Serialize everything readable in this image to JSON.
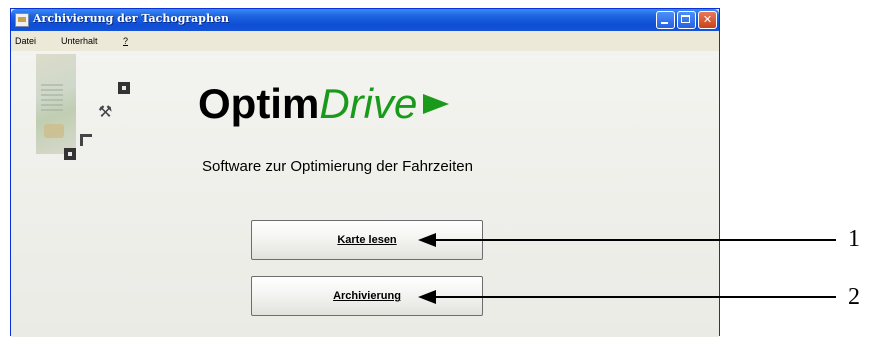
{
  "window": {
    "title": "Archivierung der Tachographen",
    "controls": {
      "minimize": "_",
      "maximize": "□",
      "close": "✕"
    }
  },
  "menu": {
    "items": [
      "Datei",
      "Unterhalt",
      "?"
    ]
  },
  "logo": {
    "part1": "Optim",
    "part2": "Drive",
    "accent_color": "#1a9a1a"
  },
  "subtitle": "Software zur Optimierung der Fahrzeiten",
  "buttons": {
    "read_card": "Karte lesen",
    "archive": "Archivierung"
  },
  "callouts": {
    "one": "1",
    "two": "2"
  },
  "icons": [
    "card-image-icon",
    "tools-icon",
    "square-icon",
    "arrow-right-icon"
  ]
}
